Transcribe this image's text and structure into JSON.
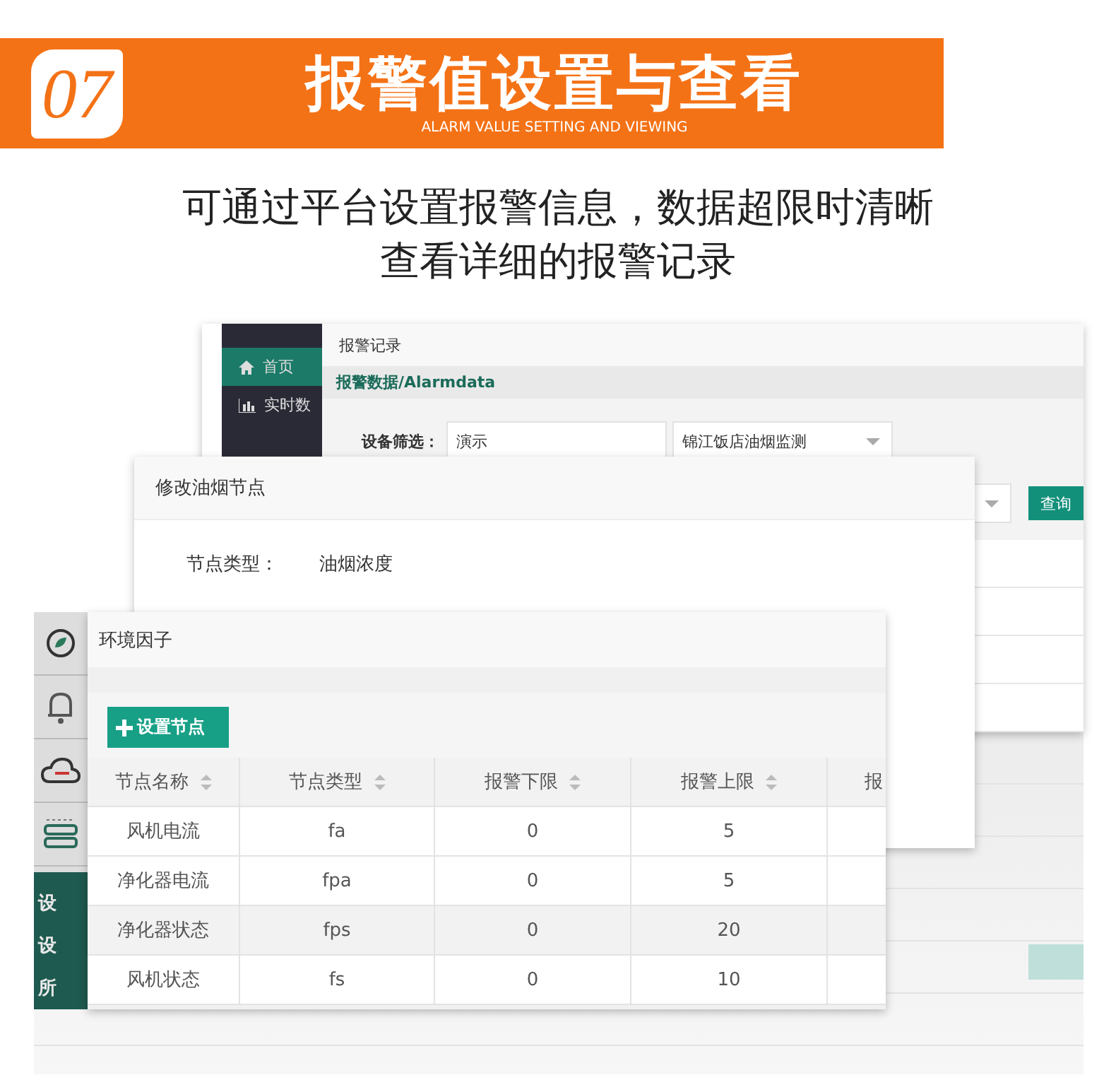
{
  "banner": {
    "number": "07",
    "title": "报警值设置与查看",
    "subtitle": "ALARM VALUE SETTING AND VIEWING"
  },
  "description": [
    "可通过平台设置报警信息，数据超限时清晰",
    "查看详细的报警记录"
  ],
  "alarm_window": {
    "sidebar": [
      {
        "label": "首页",
        "selected": true
      },
      {
        "label": "实时数",
        "selected": false
      }
    ],
    "header": "报警记录",
    "breadcrumb": "报警数据/Alarmdata",
    "filter_label": "设备筛选：",
    "device_field": "演示",
    "site_select": "锦江饭店油烟监测",
    "query_button": "查询"
  },
  "edit_window": {
    "title": "修改油烟节点",
    "field_label": "节点类型：",
    "field_value": "油烟浓度"
  },
  "side_window": {
    "menu": [
      "设",
      "设",
      "所"
    ]
  },
  "factor_window": {
    "title": "环境因子",
    "add_button": "设置节点",
    "columns": [
      "节点名称",
      "节点类型",
      "报警下限",
      "报警上限",
      "报"
    ],
    "rows": [
      [
        "风机电流",
        "fa",
        "0",
        "5"
      ],
      [
        "净化器电流",
        "fpa",
        "0",
        "5"
      ],
      [
        "净化器状态",
        "fps",
        "0",
        "20"
      ],
      [
        "风机状态",
        "fs",
        "0",
        "10"
      ]
    ]
  }
}
